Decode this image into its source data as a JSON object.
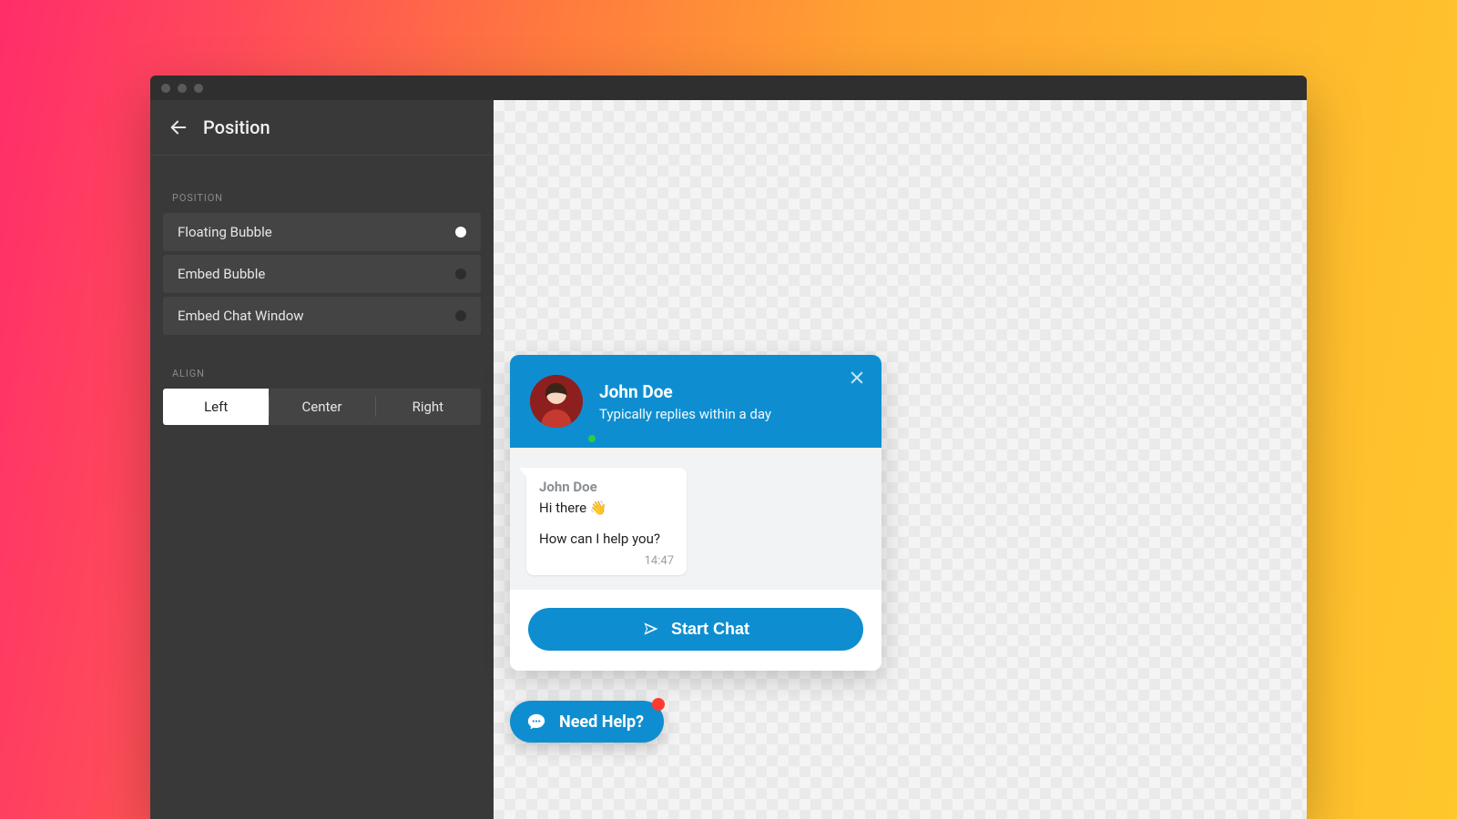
{
  "sidebar": {
    "title": "Position",
    "sections": {
      "position_label": "POSITION",
      "align_label": "ALIGN"
    },
    "position_options": [
      {
        "label": "Floating Bubble",
        "selected": true
      },
      {
        "label": "Embed Bubble",
        "selected": false
      },
      {
        "label": "Embed Chat Window",
        "selected": false
      }
    ],
    "align_options": [
      {
        "label": "Left",
        "selected": true
      },
      {
        "label": "Center",
        "selected": false
      },
      {
        "label": "Right",
        "selected": false
      }
    ]
  },
  "chat": {
    "agent_name": "John Doe",
    "agent_subtitle": "Typically replies within a day",
    "message": {
      "sender": "John Doe",
      "line1": "Hi there 👋",
      "line2": "How can I help you?",
      "time": "14:47"
    },
    "start_button": "Start Chat",
    "help_button": "Need Help?"
  },
  "colors": {
    "accent": "#0e8ed0",
    "badge": "#ff3b30",
    "presence": "#2ecc40"
  }
}
